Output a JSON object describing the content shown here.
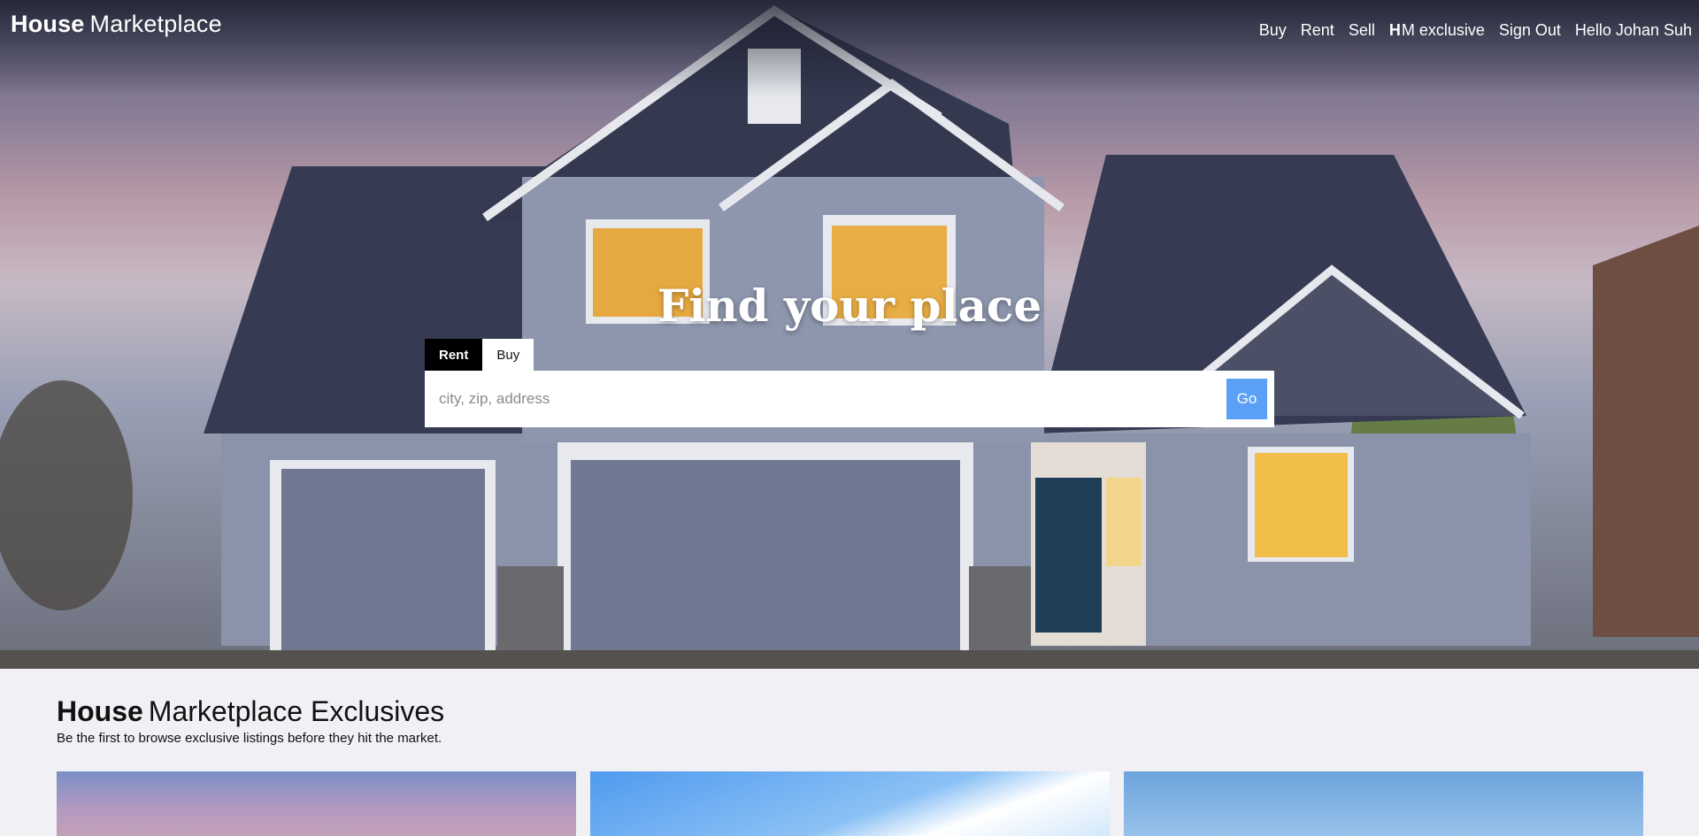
{
  "brand": {
    "bold": "House",
    "regular": "Marketplace"
  },
  "nav": {
    "buy": "Buy",
    "rent": "Rent",
    "sell": "Sell",
    "hm_logo": "H",
    "hm_exclusive": "M exclusive",
    "sign_out": "Sign Out",
    "greeting": "Hello Johan Suh"
  },
  "hero": {
    "headline": "Find your place",
    "tabs": [
      {
        "label": "Rent",
        "active": true
      },
      {
        "label": "Buy",
        "active": false
      }
    ],
    "search": {
      "placeholder": "city, zip, address",
      "value": ""
    },
    "go_label": "Go"
  },
  "exclusives": {
    "title_bold": "House",
    "title_regular": "Marketplace Exclusives",
    "subtitle": "Be the first to browse exclusive listings before they hit the market."
  },
  "colors": {
    "go_button": "#5aa0f6",
    "active_tab": "#000000",
    "page_background": "#f0f0f5"
  }
}
